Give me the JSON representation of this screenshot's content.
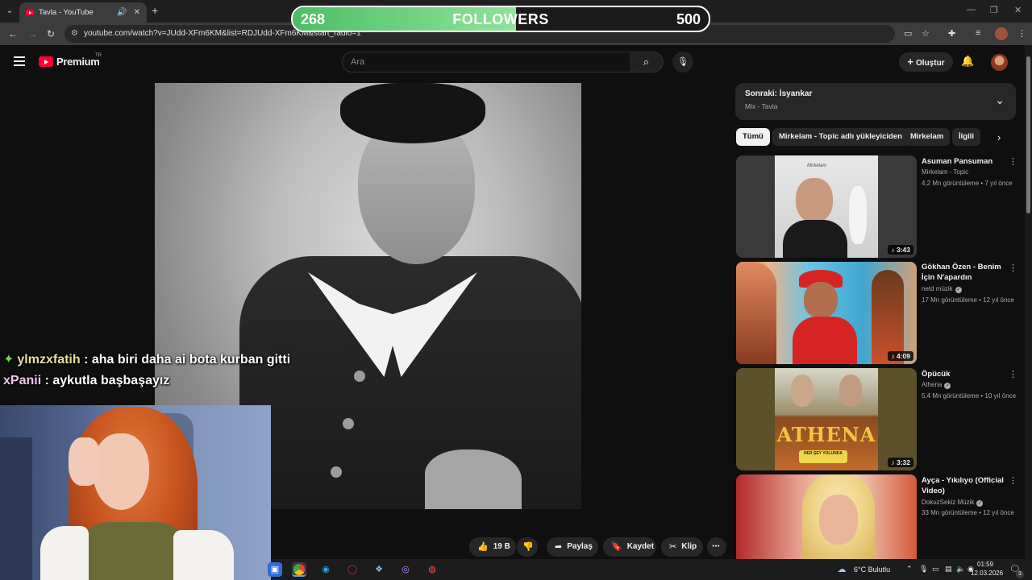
{
  "browser": {
    "tab_title": "Tavla - YouTube",
    "url": "youtube.com/watch?v=JUdd-XFm6KM&list=RDJUdd-XFm6KM&start_radio=1"
  },
  "overlay": {
    "followers_current": "268",
    "followers_label": "FOLLOWERS",
    "followers_goal": "500",
    "progress_fraction": 0.536
  },
  "header": {
    "logo_text": "Premium",
    "logo_region": "TR",
    "search_placeholder": "Ara",
    "create_label": "Oluştur"
  },
  "actions": {
    "like_count": "19 B",
    "share_label": "Paylaş",
    "save_label": "Kaydet",
    "clip_label": "Klip"
  },
  "next_up": {
    "title": "Sonraki: İsyankar",
    "subtitle": "Mix - Tavla"
  },
  "chips": [
    "Tümü",
    "Mirkelam - Topic adlı yükleyiciden",
    "Mirkelam",
    "İlgili"
  ],
  "recommendations": [
    {
      "title": "Asuman Pansuman",
      "channel": "Mirkelam - Topic",
      "meta": "4,2 Mn görüntüleme • 7 yıl önce",
      "duration": "3:43",
      "verified": false
    },
    {
      "title": "Gökhan Özen - Benim İçin N'apardın",
      "channel": "netd müzik",
      "meta": "17 Mn görüntüleme • 12 yıl önce",
      "duration": "4:09",
      "verified": true
    },
    {
      "title": "Öpücük",
      "channel": "Athena",
      "meta": "5,4 Mn görüntüleme • 10 yıl önce",
      "duration": "3:32",
      "verified": true
    },
    {
      "title": "Ayça - Yıkılıyo (Official Video)",
      "channel": "DokuzSekiz Müzik",
      "meta": "33 Mn görüntüleme • 12 yıl önce",
      "duration": "",
      "verified": true
    }
  ],
  "thumb_text": {
    "athena_logo": "ATHENA",
    "athena_sticker": "HER ŞEY YOLUNDA",
    "album_caption": "Mirkelam"
  },
  "chat": [
    {
      "user": "ylmzxfatih",
      "message": ": aha biri daha ai bota kurban gitti"
    },
    {
      "user": "xPanii",
      "message": ": aykutla başbaşayız"
    }
  ],
  "taskbar": {
    "weather": "6°C Bulutlu",
    "time": "01:59",
    "date": "12.03.2026",
    "notif_count": "3"
  },
  "colors": {
    "yt_red": "#ff0033",
    "progress_green": "#4cbf62",
    "background": "#0f0f0f"
  }
}
